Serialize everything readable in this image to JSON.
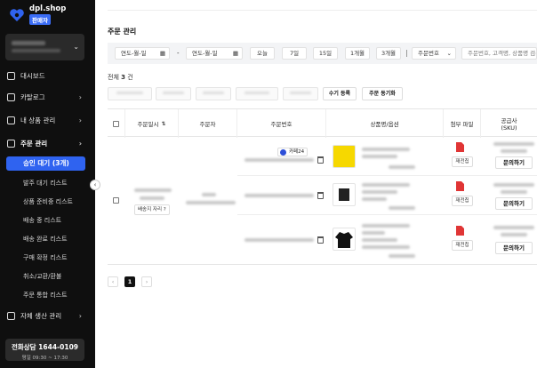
{
  "brand": {
    "name": "dpl.shop",
    "badge": "판매자"
  },
  "sidebar": {
    "items": [
      {
        "label": "대시보드"
      },
      {
        "label": "카탈로그"
      },
      {
        "label": "내 상품 관리"
      },
      {
        "label": "주문 관리"
      }
    ],
    "order_subs": [
      {
        "label": "승인 대기 (3개)"
      },
      {
        "label": "발주 대기 리스트"
      },
      {
        "label": "상품 준비중 리스트"
      },
      {
        "label": "배송 중 리스트"
      },
      {
        "label": "배송 완료 리스트"
      },
      {
        "label": "구매 확정 리스트"
      },
      {
        "label": "취소/교환/환불"
      },
      {
        "label": "주문 통합 리스트"
      }
    ],
    "bottom_item": {
      "label": "자체 생산 관리"
    },
    "call": {
      "title": "전화상담 1644-0109",
      "hours": "평일 09:30 ~ 17:30"
    }
  },
  "page": {
    "title": "주문 관리"
  },
  "filters": {
    "date_start": "연도-월-일",
    "date_sep": "-",
    "date_end": "연도-월-일",
    "quick": [
      "오늘",
      "7일",
      "15일",
      "1개월",
      "3개월"
    ],
    "search_type": "주문번호",
    "search_placeholder": "주문번호, 고객명, 상품명 검색"
  },
  "summary": {
    "prefix": "전체",
    "count": "3",
    "suffix": "건"
  },
  "actions": [
    "",
    "",
    "",
    "",
    "",
    "수기 등록",
    "주문 동기화"
  ],
  "table": {
    "headers": [
      "주문일시",
      "주문자",
      "주문번호",
      "상품명/옵션",
      "첨부 파일",
      "공급사\n(SKU)"
    ],
    "order_tag": "카페24",
    "address_chip": "배송지 자리 ?",
    "file_btn": "재전칩",
    "inquiry_btn": "문의하기"
  },
  "pagination": {
    "current": "1"
  },
  "colors": {
    "accent": "#2f63f0",
    "sidebar_bg": "#0f0f0f",
    "pdf": "#e03535"
  }
}
